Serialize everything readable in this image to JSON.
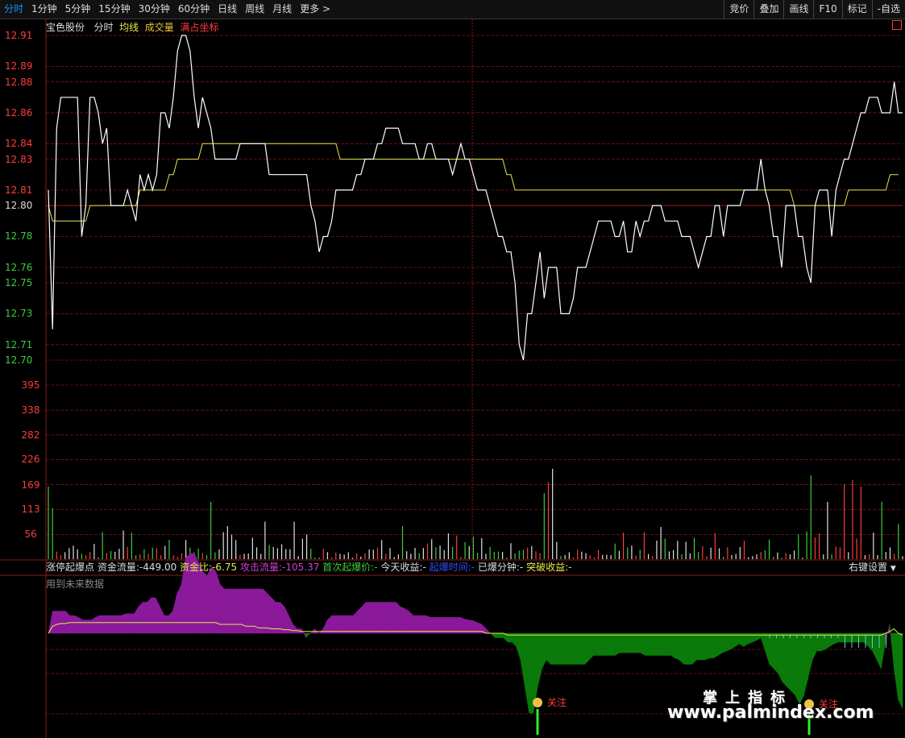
{
  "toolbar": {
    "tabs": [
      "分时",
      "1分钟",
      "5分钟",
      "15分钟",
      "30分钟",
      "60分钟",
      "日线",
      "周线",
      "月线",
      "更多"
    ],
    "more_arrow": ">",
    "right_buttons": [
      "竞价",
      "叠加",
      "画线",
      "F10",
      "标记",
      "-自选"
    ]
  },
  "price_panel": {
    "stock_name": "宝色股份",
    "mode": "分时",
    "avg_line_label": "均线",
    "volume_label": "成交量",
    "fullscreen_label": "满占坐标",
    "y_labels": [
      "12.91",
      "12.89",
      "12.88",
      "12.86",
      "12.84",
      "12.83",
      "12.81",
      "12.80",
      "12.78",
      "12.76",
      "12.75",
      "12.73",
      "12.71",
      "12.70"
    ],
    "y_colors": {
      "up": "#ff3c3c",
      "base": "#dddddd",
      "down": "#3ccc3c"
    }
  },
  "volume_panel": {
    "y_labels": [
      "395",
      "338",
      "282",
      "226",
      "169",
      "113",
      "56"
    ]
  },
  "indicator_panel": {
    "name": "涨停起爆点",
    "fund_flow_label": "资金流量:",
    "fund_flow_value": "-449.00",
    "fund_ratio_label": "资金比:",
    "fund_ratio_value": "-6.75",
    "attack_flow_label": "攻击流量:",
    "attack_flow_value": "-105.37",
    "first_burst_label": "首次起爆价:",
    "first_burst_value": "-",
    "today_gain_label": "今天收益:",
    "today_gain_value": "-",
    "burst_time_label": "起爆时间:",
    "burst_time_value": "-",
    "burst_minute_label": "已爆分钟:",
    "burst_minute_value": "-",
    "breakout_gain_label": "突破收益:",
    "breakout_gain_value": "-",
    "settings_label": "右键设置",
    "settings_arrow": "▼",
    "future_data_note": "用到未来数据",
    "watch_signal_1": "关注",
    "watch_signal_2": "关注"
  },
  "watermark": {
    "line1": "掌上指标",
    "line2": "www.palmindex.com"
  },
  "series": {
    "price": [
      12.81,
      12.72,
      12.85,
      12.87,
      12.87,
      12.87,
      12.87,
      12.87,
      12.78,
      12.8,
      12.87,
      12.87,
      12.86,
      12.84,
      12.85,
      12.8,
      12.8,
      12.8,
      12.8,
      12.81,
      12.8,
      12.79,
      12.82,
      12.81,
      12.82,
      12.81,
      12.82,
      12.86,
      12.86,
      12.85,
      12.87,
      12.9,
      12.91,
      12.91,
      12.9,
      12.87,
      12.85,
      12.87,
      12.86,
      12.85,
      12.83,
      12.83,
      12.83,
      12.83,
      12.83,
      12.83,
      12.84,
      12.84,
      12.84,
      12.84,
      12.84,
      12.84,
      12.84,
      12.82,
      12.82,
      12.82,
      12.82,
      12.82,
      12.82,
      12.82,
      12.82,
      12.82,
      12.82,
      12.8,
      12.79,
      12.77,
      12.78,
      12.78,
      12.79,
      12.81,
      12.81,
      12.81,
      12.81,
      12.81,
      12.82,
      12.82,
      12.83,
      12.83,
      12.83,
      12.84,
      12.84,
      12.85,
      12.85,
      12.85,
      12.85,
      12.84,
      12.84,
      12.84,
      12.84,
      12.83,
      12.83,
      12.84,
      12.84,
      12.83,
      12.83,
      12.83,
      12.83,
      12.82,
      12.83,
      12.84,
      12.83,
      12.83,
      12.82,
      12.81,
      12.81,
      12.81,
      12.8,
      12.79,
      12.78,
      12.78,
      12.77,
      12.77,
      12.75,
      12.71,
      12.7,
      12.73,
      12.73,
      12.75,
      12.77,
      12.74,
      12.76,
      12.76,
      12.76,
      12.73,
      12.73,
      12.73,
      12.74,
      12.76,
      12.76,
      12.76,
      12.77,
      12.78,
      12.79,
      12.79,
      12.79,
      12.79,
      12.78,
      12.78,
      12.79,
      12.77,
      12.77,
      12.79,
      12.78,
      12.79,
      12.79,
      12.8,
      12.8,
      12.8,
      12.79,
      12.79,
      12.79,
      12.79,
      12.78,
      12.78,
      12.78,
      12.77,
      12.76,
      12.77,
      12.78,
      12.78,
      12.8,
      12.8,
      12.78,
      12.8,
      12.8,
      12.8,
      12.8,
      12.81,
      12.81,
      12.81,
      12.81,
      12.83,
      12.81,
      12.8,
      12.78,
      12.78,
      12.76,
      12.8,
      12.8,
      12.8,
      12.78,
      12.78,
      12.76,
      12.75,
      12.8,
      12.81,
      12.81,
      12.81,
      12.78,
      12.81,
      12.82,
      12.83,
      12.83,
      12.84,
      12.85,
      12.86,
      12.86,
      12.87,
      12.87,
      12.87,
      12.86,
      12.86,
      12.86,
      12.88,
      12.86,
      12.86
    ],
    "average": [
      12.8,
      12.79,
      12.79,
      12.79,
      12.79,
      12.79,
      12.79,
      12.79,
      12.79,
      12.79,
      12.8,
      12.8,
      12.8,
      12.8,
      12.8,
      12.8,
      12.8,
      12.8,
      12.8,
      12.8,
      12.8,
      12.8,
      12.81,
      12.81,
      12.81,
      12.81,
      12.81,
      12.81,
      12.81,
      12.82,
      12.82,
      12.83,
      12.83,
      12.83,
      12.83,
      12.83,
      12.83,
      12.84,
      12.84,
      12.84,
      12.84,
      12.84,
      12.84,
      12.84,
      12.84,
      12.84,
      12.84,
      12.84,
      12.84,
      12.84,
      12.84,
      12.84,
      12.84,
      12.84,
      12.84,
      12.84,
      12.84,
      12.84,
      12.84,
      12.84,
      12.84,
      12.84,
      12.84,
      12.84,
      12.84,
      12.84,
      12.84,
      12.84,
      12.84,
      12.84,
      12.83,
      12.83,
      12.83,
      12.83,
      12.83,
      12.83,
      12.83,
      12.83,
      12.83,
      12.83,
      12.83,
      12.83,
      12.83,
      12.83,
      12.83,
      12.83,
      12.83,
      12.83,
      12.83,
      12.83,
      12.83,
      12.83,
      12.83,
      12.83,
      12.83,
      12.83,
      12.83,
      12.83,
      12.83,
      12.83,
      12.83,
      12.83,
      12.83,
      12.83,
      12.83,
      12.83,
      12.83,
      12.83,
      12.83,
      12.83,
      12.82,
      12.82,
      12.81,
      12.81,
      12.81,
      12.81,
      12.81,
      12.81,
      12.81,
      12.81,
      12.81,
      12.81,
      12.81,
      12.81,
      12.81,
      12.81,
      12.81,
      12.81,
      12.81,
      12.81,
      12.81,
      12.81,
      12.81,
      12.81,
      12.81,
      12.81,
      12.81,
      12.81,
      12.81,
      12.81,
      12.81,
      12.81,
      12.81,
      12.81,
      12.81,
      12.81,
      12.81,
      12.81,
      12.81,
      12.81,
      12.81,
      12.81,
      12.81,
      12.81,
      12.81,
      12.81,
      12.81,
      12.81,
      12.81,
      12.81,
      12.81,
      12.81,
      12.81,
      12.81,
      12.81,
      12.81,
      12.81,
      12.81,
      12.81,
      12.81,
      12.81,
      12.81,
      12.81,
      12.81,
      12.81,
      12.81,
      12.81,
      12.81,
      12.81,
      12.8,
      12.8,
      12.8,
      12.8,
      12.8,
      12.8,
      12.8,
      12.8,
      12.8,
      12.8,
      12.8,
      12.8,
      12.8,
      12.81,
      12.81,
      12.81,
      12.81,
      12.81,
      12.81,
      12.81,
      12.81,
      12.81,
      12.81,
      12.82,
      12.82,
      12.82
    ],
    "flow": [
      0.0,
      0.25,
      0.25,
      0.25,
      0.25,
      0.2,
      0.2,
      0.18,
      0.15,
      0.15,
      0.15,
      0.18,
      0.2,
      0.2,
      0.2,
      0.2,
      0.2,
      0.2,
      0.22,
      0.22,
      0.22,
      0.3,
      0.35,
      0.35,
      0.4,
      0.4,
      0.3,
      0.2,
      0.2,
      0.25,
      0.45,
      0.55,
      0.85,
      0.9,
      0.9,
      0.8,
      0.7,
      0.65,
      0.75,
      0.7,
      0.55,
      0.5,
      0.5,
      0.5,
      0.5,
      0.5,
      0.5,
      0.5,
      0.5,
      0.5,
      0.5,
      0.45,
      0.4,
      0.35,
      0.35,
      0.3,
      0.2,
      0.1,
      0.05,
      0.05,
      -0.05,
      0.0,
      0.05,
      0.0,
      0.05,
      0.15,
      0.2,
      0.2,
      0.2,
      0.2,
      0.2,
      0.2,
      0.25,
      0.3,
      0.35,
      0.35,
      0.35,
      0.35,
      0.35,
      0.35,
      0.35,
      0.35,
      0.3,
      0.28,
      0.25,
      0.2,
      0.2,
      0.2,
      0.2,
      0.18,
      0.18,
      0.18,
      0.18,
      0.18,
      0.18,
      0.18,
      0.18,
      0.16,
      0.15,
      0.14,
      0.12,
      0.1,
      0.05,
      0.0,
      -0.05,
      -0.05,
      -0.05,
      -0.1,
      -0.1,
      -0.15,
      -0.3,
      -0.6,
      -0.9,
      -0.9,
      -0.6,
      -0.4,
      -0.3,
      -0.35,
      -0.35,
      -0.35,
      -0.35,
      -0.35,
      -0.35,
      -0.35,
      -0.35,
      -0.35,
      -0.3,
      -0.25,
      -0.25,
      -0.25,
      -0.25,
      -0.25,
      -0.25,
      -0.22,
      -0.22,
      -0.22,
      -0.22,
      -0.22,
      -0.22,
      -0.25,
      -0.25,
      -0.25,
      -0.25,
      -0.25,
      -0.25,
      -0.25,
      -0.28,
      -0.3,
      -0.35,
      -0.35,
      -0.35,
      -0.3,
      -0.3,
      -0.3,
      -0.28,
      -0.28,
      -0.25,
      -0.22,
      -0.2,
      -0.18,
      -0.15,
      -0.12,
      -0.15,
      -0.12,
      -0.1,
      -0.08,
      -0.05,
      -0.2,
      -0.35,
      -0.4,
      -0.45,
      -0.55,
      -0.6,
      -0.65,
      -0.7,
      -0.8,
      -0.7,
      -0.5,
      -0.3,
      -0.2,
      -0.2,
      -0.18,
      -0.15,
      -0.12,
      -0.1,
      -0.1,
      -0.1,
      -0.1,
      -0.1,
      -0.1,
      -0.1,
      -0.15,
      -0.2,
      -0.3,
      -0.4,
      -0.1,
      0.1,
      -0.4,
      -0.75,
      -0.85
    ],
    "flow_avg": [
      0.0,
      0.08,
      0.1,
      0.11,
      0.11,
      0.12,
      0.12,
      0.12,
      0.12,
      0.12,
      0.12,
      0.12,
      0.12,
      0.12,
      0.12,
      0.12,
      0.12,
      0.12,
      0.12,
      0.12,
      0.12,
      0.12,
      0.12,
      0.12,
      0.12,
      0.12,
      0.12,
      0.12,
      0.12,
      0.12,
      0.12,
      0.12,
      0.12,
      0.12,
      0.12,
      0.12,
      0.12,
      0.12,
      0.12,
      0.12,
      0.1,
      0.1,
      0.1,
      0.1,
      0.1,
      0.1,
      0.08,
      0.08,
      0.08,
      0.06,
      0.06,
      0.06,
      0.05,
      0.05,
      0.05,
      0.04,
      0.04,
      0.03,
      0.03,
      0.02,
      0.02,
      0.02,
      0.02,
      0.02,
      0.02,
      0.02,
      0.02,
      0.02,
      0.02,
      0.02,
      0.02,
      0.02,
      0.02,
      0.02,
      0.02,
      0.02,
      0.02,
      0.02,
      0.02,
      0.02,
      0.02,
      0.02,
      0.02,
      0.02,
      0.02,
      0.02,
      0.02,
      0.02,
      0.02,
      0.02,
      0.02,
      0.02,
      0.02,
      0.02,
      0.02,
      0.02,
      0.02,
      0.02,
      0.02,
      0.02,
      0.02,
      0.02,
      0.0,
      0.0,
      0.0,
      0.0,
      0.0,
      -0.02,
      -0.02,
      -0.02,
      -0.02,
      -0.02,
      -0.02,
      -0.02,
      -0.02,
      -0.02,
      -0.02,
      -0.02,
      -0.02,
      -0.02,
      -0.02,
      -0.02,
      -0.02,
      -0.02,
      -0.02,
      -0.02,
      -0.02,
      -0.02,
      -0.02,
      -0.02,
      -0.02,
      -0.02,
      -0.02,
      -0.02,
      -0.02,
      -0.02,
      -0.02,
      -0.02,
      -0.02,
      -0.02,
      -0.02,
      -0.02,
      -0.02,
      -0.02,
      -0.02,
      -0.02,
      -0.02,
      -0.02,
      -0.02,
      -0.02,
      -0.02,
      -0.02,
      -0.02,
      -0.02,
      -0.02,
      -0.02,
      -0.02,
      -0.02,
      -0.02,
      -0.02,
      -0.02,
      -0.02,
      -0.02,
      -0.02,
      -0.02,
      -0.02,
      -0.02,
      -0.02,
      -0.02,
      -0.02,
      -0.02,
      -0.02,
      -0.02,
      -0.02,
      -0.02,
      -0.02,
      -0.02,
      -0.02,
      -0.02,
      -0.02,
      -0.02,
      -0.02,
      -0.02,
      -0.02,
      -0.02,
      -0.02,
      -0.02,
      -0.02,
      -0.02,
      -0.02,
      -0.02,
      -0.02,
      -0.02,
      -0.02,
      -0.02,
      0.0,
      0.02,
      0.05,
      0.0,
      -0.02
    ]
  }
}
